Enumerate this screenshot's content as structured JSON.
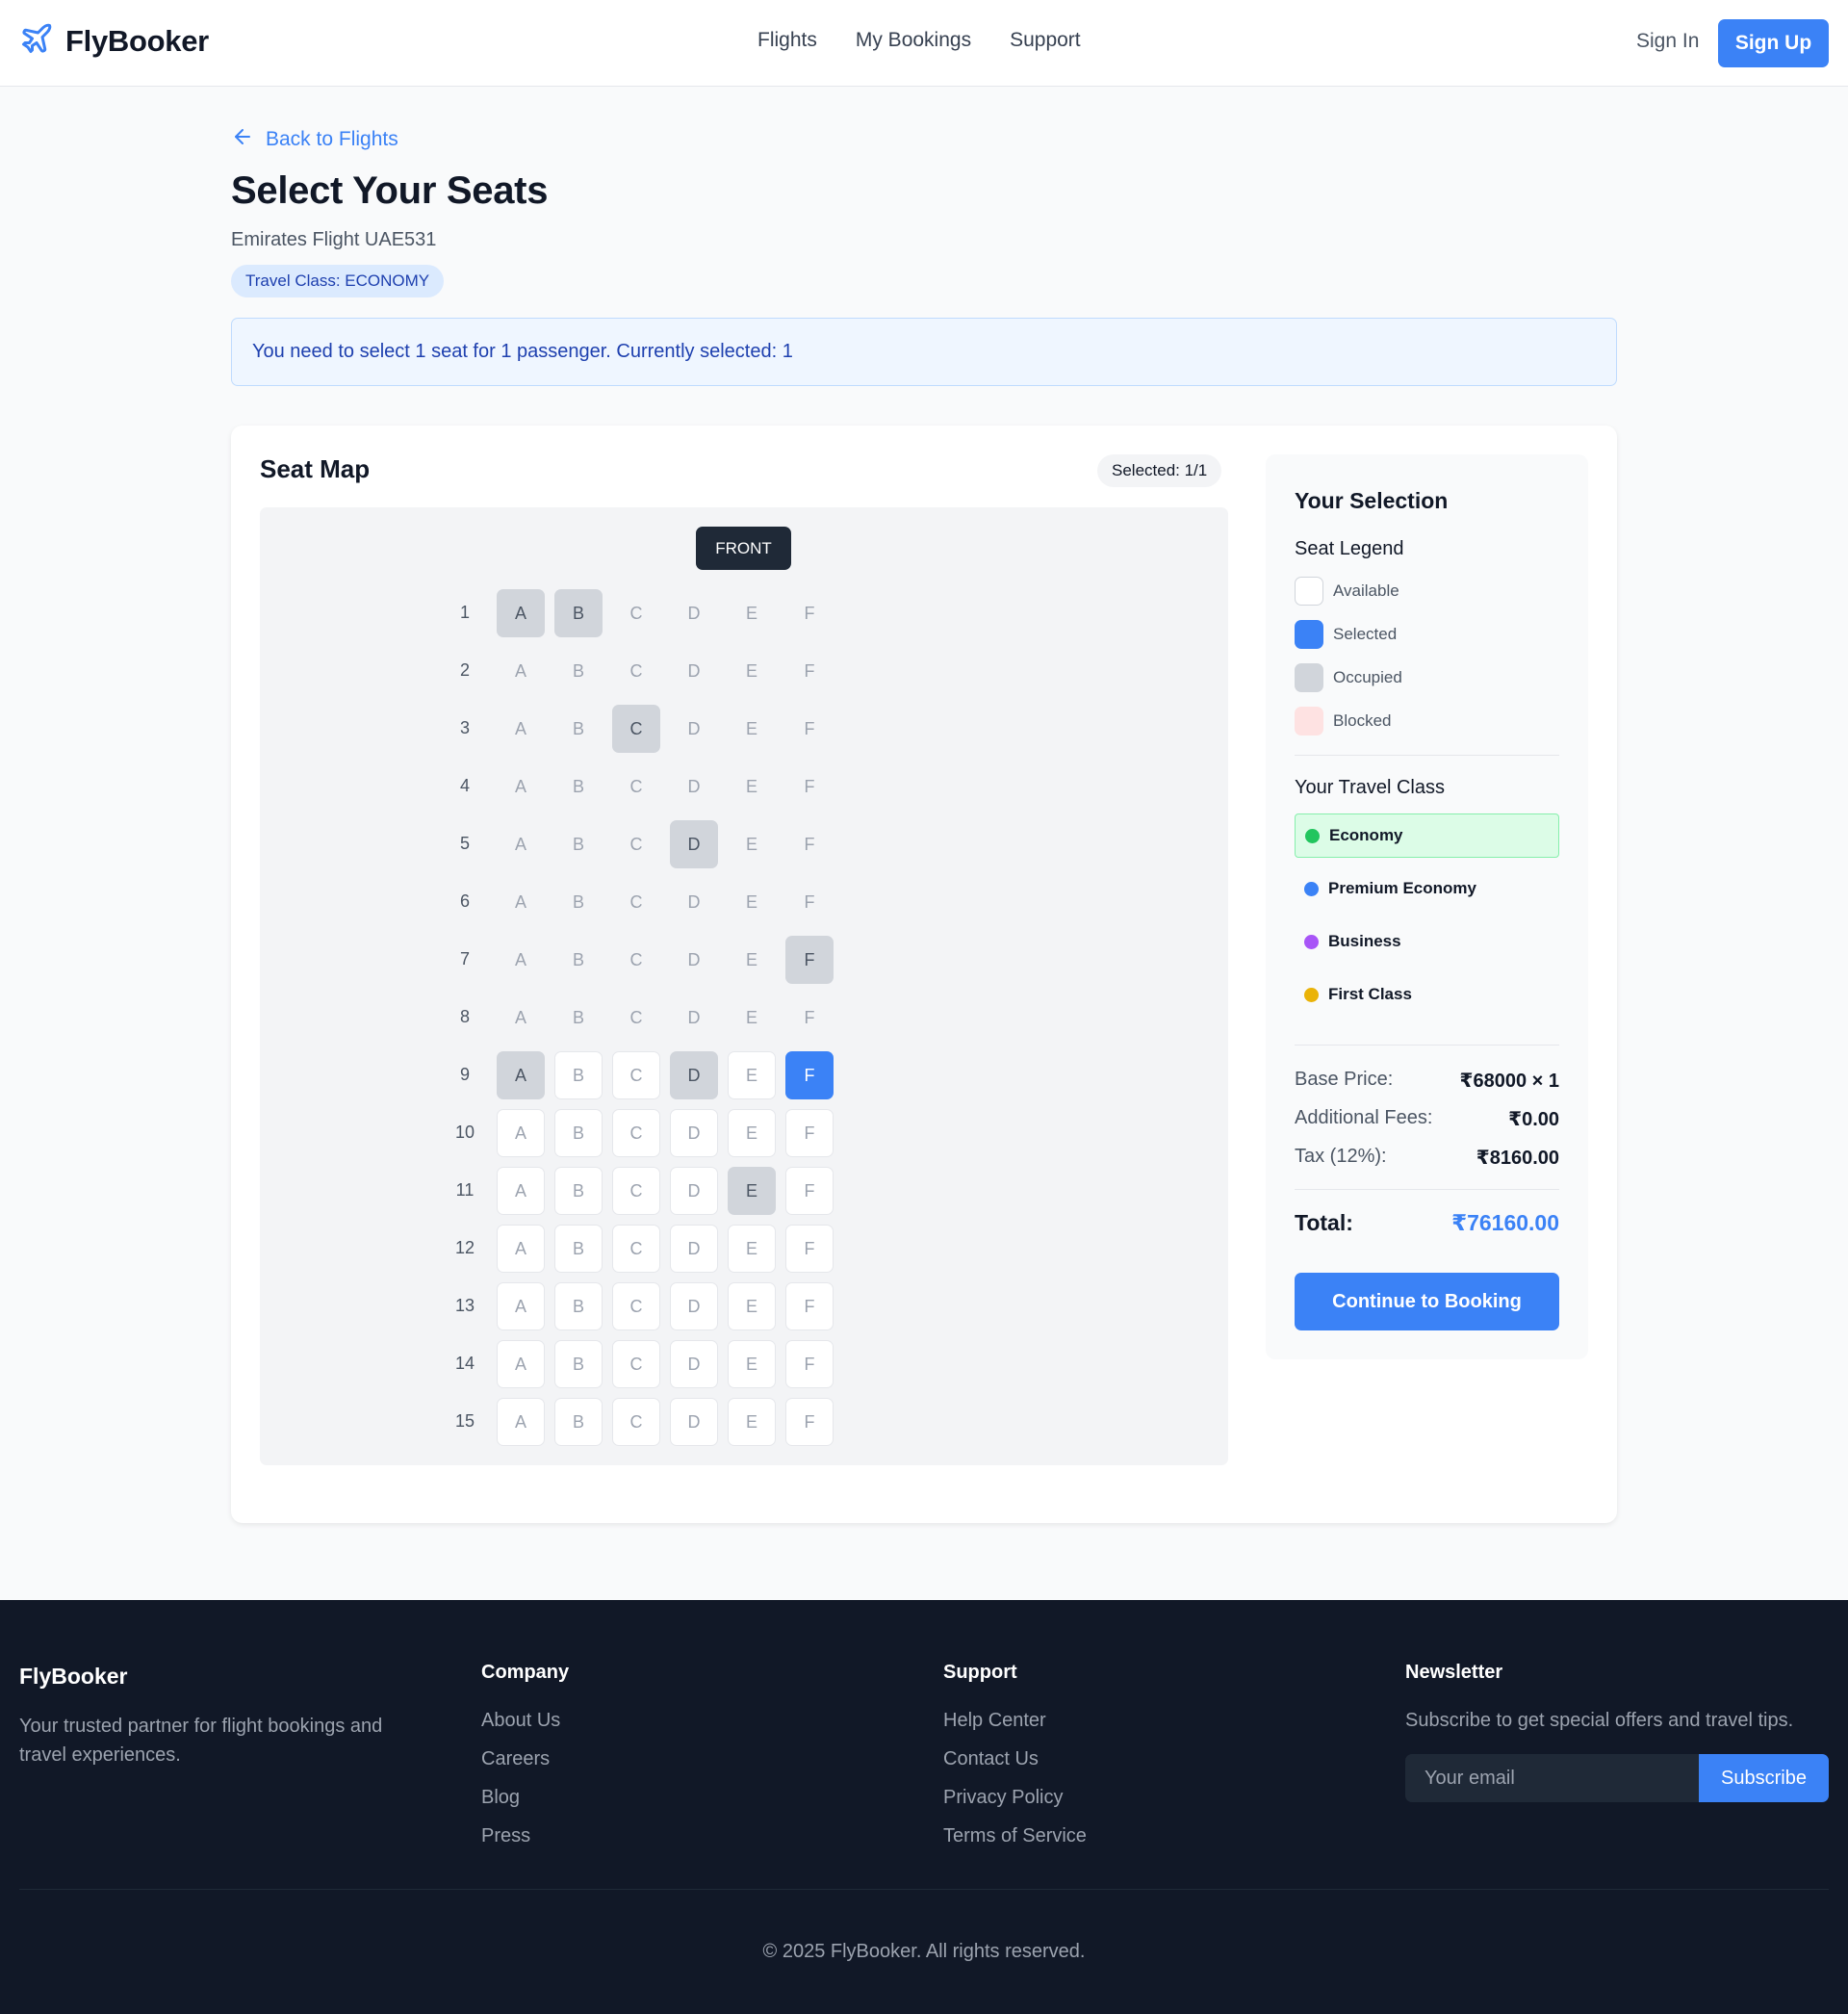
{
  "header": {
    "brand": "FlyBooker",
    "nav": [
      "Flights",
      "My Bookings",
      "Support"
    ],
    "sign_in": "Sign In",
    "sign_up": "Sign Up"
  },
  "page": {
    "back_link": "Back to Flights",
    "title": "Select Your Seats",
    "flight": "Emirates Flight UAE531",
    "class_badge": "Travel Class: ECONOMY",
    "banner": "You need to select 1 seat for 1 passenger. Currently selected: 1"
  },
  "seat_map": {
    "title": "Seat Map",
    "selected_pill": "Selected: 1/1",
    "front_label": "FRONT",
    "columns": [
      "A",
      "B",
      "C",
      "D",
      "E",
      "F"
    ],
    "rows": [
      {
        "row": "1",
        "states": [
          "occupied",
          "occupied",
          "plain",
          "plain",
          "plain",
          "plain"
        ]
      },
      {
        "row": "2",
        "states": [
          "plain",
          "plain",
          "plain",
          "plain",
          "plain",
          "plain"
        ]
      },
      {
        "row": "3",
        "states": [
          "plain",
          "plain",
          "occupied",
          "plain",
          "plain",
          "plain"
        ]
      },
      {
        "row": "4",
        "states": [
          "plain",
          "plain",
          "plain",
          "plain",
          "plain",
          "plain"
        ]
      },
      {
        "row": "5",
        "states": [
          "plain",
          "plain",
          "plain",
          "occupied",
          "plain",
          "plain"
        ]
      },
      {
        "row": "6",
        "states": [
          "plain",
          "plain",
          "plain",
          "plain",
          "plain",
          "plain"
        ]
      },
      {
        "row": "7",
        "states": [
          "plain",
          "plain",
          "plain",
          "plain",
          "plain",
          "occupied"
        ]
      },
      {
        "row": "8",
        "states": [
          "plain",
          "plain",
          "plain",
          "plain",
          "plain",
          "plain"
        ]
      },
      {
        "row": "9",
        "states": [
          "occupied",
          "available",
          "available",
          "occupied",
          "available",
          "selected"
        ]
      },
      {
        "row": "10",
        "states": [
          "available",
          "available",
          "available",
          "available",
          "available",
          "available"
        ]
      },
      {
        "row": "11",
        "states": [
          "available",
          "available",
          "available",
          "available",
          "occupied",
          "available"
        ]
      },
      {
        "row": "12",
        "states": [
          "available",
          "available",
          "available",
          "available",
          "available",
          "available"
        ]
      },
      {
        "row": "13",
        "states": [
          "available",
          "available",
          "available",
          "available",
          "available",
          "available"
        ]
      },
      {
        "row": "14",
        "states": [
          "available",
          "available",
          "available",
          "available",
          "available",
          "available"
        ]
      },
      {
        "row": "15",
        "states": [
          "available",
          "available",
          "available",
          "available",
          "available",
          "available"
        ]
      }
    ]
  },
  "sidebar": {
    "title": "Your Selection",
    "legend_title": "Seat Legend",
    "legend": [
      {
        "label": "Available",
        "color": "#ffffff",
        "border": "#d1d5db"
      },
      {
        "label": "Selected",
        "color": "#3b82f6",
        "border": "#3b82f6"
      },
      {
        "label": "Occupied",
        "color": "#d1d5db",
        "border": "#d1d5db"
      },
      {
        "label": "Blocked",
        "color": "#fee2e2",
        "border": "#fee2e2"
      }
    ],
    "travel_class_title": "Your Travel Class",
    "classes": [
      {
        "label": "Economy",
        "dot": "#22c55e",
        "active": true
      },
      {
        "label": "Premium Economy",
        "dot": "#3b82f6",
        "active": false
      },
      {
        "label": "Business",
        "dot": "#a855f7",
        "active": false
      },
      {
        "label": "First Class",
        "dot": "#eab308",
        "active": false
      }
    ],
    "base_price_label": "Base Price:",
    "base_price_value": "₹68000 × 1",
    "fees_label": "Additional Fees:",
    "fees_value": "₹0.00",
    "tax_label": "Tax (12%):",
    "tax_value": "₹8160.00",
    "total_label": "Total:",
    "total_value": "₹76160.00",
    "continue_label": "Continue to Booking"
  },
  "footer": {
    "brand": "FlyBooker",
    "description": "Your trusted partner for flight bookings and travel experiences.",
    "company_title": "Company",
    "company_links": [
      "About Us",
      "Careers",
      "Blog",
      "Press"
    ],
    "support_title": "Support",
    "support_links": [
      "Help Center",
      "Contact Us",
      "Privacy Policy",
      "Terms of Service"
    ],
    "newsletter_title": "Newsletter",
    "newsletter_desc": "Subscribe to get special offers and travel tips.",
    "email_placeholder": "Your email",
    "subscribe_label": "Subscribe",
    "copyright": "© 2025 FlyBooker. All rights reserved."
  },
  "colors": {
    "accent": "#3b82f6",
    "footer_bg": "#111827",
    "banner_bg": "#eff6ff",
    "occupied": "#d1d5db"
  }
}
